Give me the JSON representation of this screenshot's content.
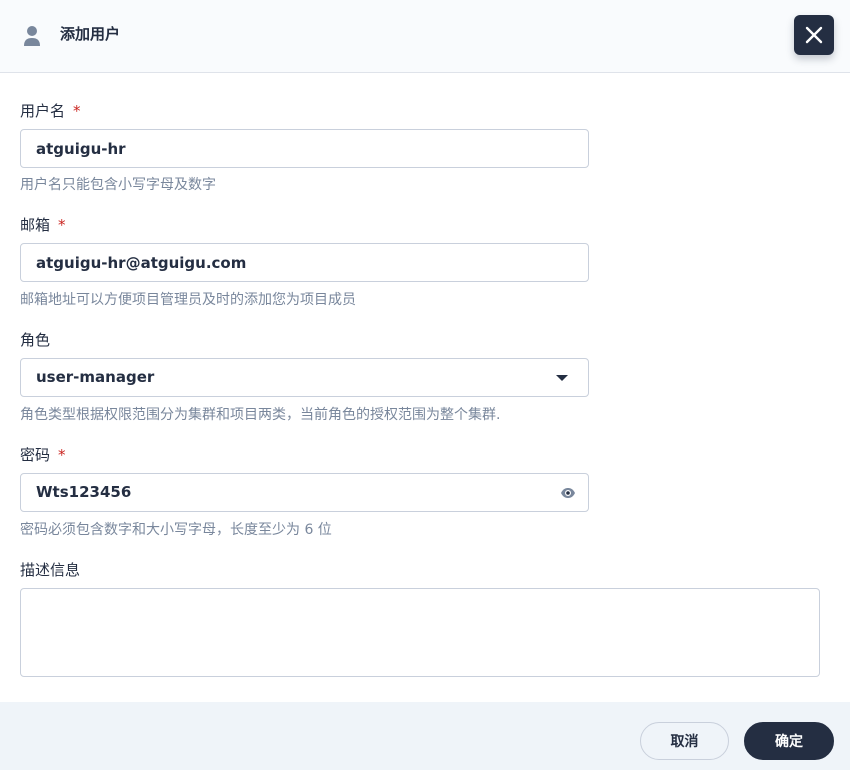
{
  "dialog": {
    "title": "添加用户",
    "header_icon": "user-icon",
    "close_icon": "close-icon"
  },
  "form": {
    "username": {
      "label": "用户名",
      "required_mark": "*",
      "value": "atguigu-hr",
      "hint": "用户名只能包含小写字母及数字"
    },
    "email": {
      "label": "邮箱",
      "required_mark": "*",
      "value": "atguigu-hr@atguigu.com",
      "hint": "邮箱地址可以方便项目管理员及时的添加您为项目成员"
    },
    "role": {
      "label": "角色",
      "selected": "user-manager",
      "hint": "角色类型根据权限范围分为集群和项目两类，当前角色的授权范围为整个集群.",
      "icon": "chevron-down-icon"
    },
    "password": {
      "label": "密码",
      "required_mark": "*",
      "value": "Wts123456",
      "hint": "密码必须包含数字和大小写字母，长度至少为 6 位",
      "icon": "eye-icon"
    },
    "description": {
      "label": "描述信息",
      "value": ""
    }
  },
  "footer": {
    "cancel_label": "取消",
    "ok_label": "确定"
  },
  "colors": {
    "primary_dark": "#242e42",
    "required": "#ca2621",
    "hint": "#79879c",
    "border": "#c9d0dc",
    "footer_bg": "#eff4f9"
  }
}
